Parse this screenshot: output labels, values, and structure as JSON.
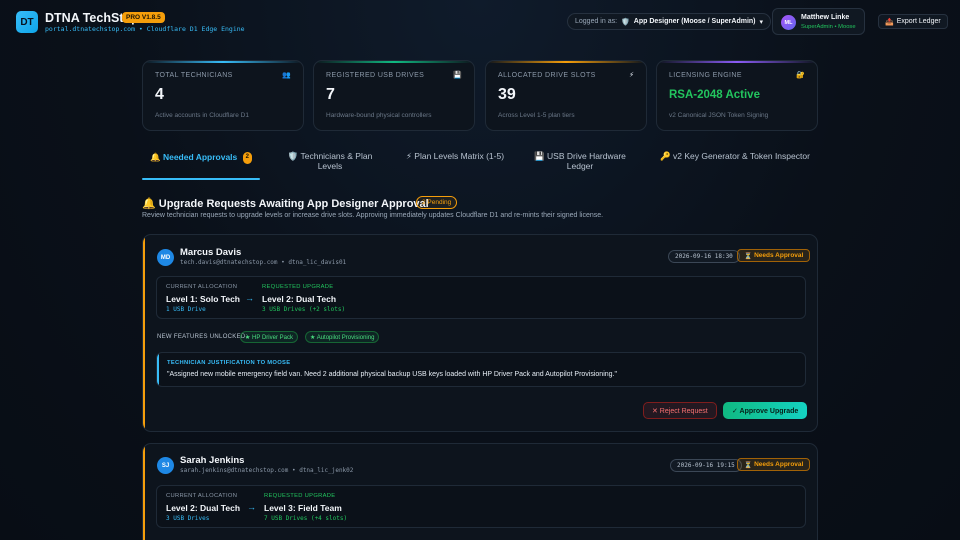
{
  "header": {
    "logo_text": "DT",
    "title": "DTNA TechStop",
    "version_badge": "PRO V1.8.5",
    "subtitle": "portal.dtnatechstop.com • Cloudflare D1 Edge Engine",
    "logged_in_label": "Logged in as:",
    "role_icon": "🛡️",
    "role_value": "App Designer (Moose / SuperAdmin)",
    "role_chevron": "▾",
    "user_initials": "ML",
    "user_name": "Matthew Linke",
    "user_role": "SuperAdmin • Moose",
    "export_icon": "📤",
    "export_label": "Export Ledger"
  },
  "stats": [
    {
      "label": "TOTAL TECHNICIANS",
      "icon": "👥",
      "value": "4",
      "desc": "Active accounts in Cloudflare D1",
      "color": "#38bdf8"
    },
    {
      "label": "REGISTERED USB DRIVES",
      "icon": "💾",
      "value": "7",
      "desc": "Hardware-bound physical controllers",
      "color": "#10b981"
    },
    {
      "label": "ALLOCATED DRIVE SLOTS",
      "icon": "⚡",
      "value": "39",
      "desc": "Across Level 1-5 plan tiers",
      "color": "#f59e0b"
    },
    {
      "label": "LICENSING ENGINE",
      "icon": "🔐",
      "value": "RSA-2048 Active",
      "desc": "v2 Canonical JSON Token Signing",
      "color": "#8b5cf6"
    }
  ],
  "tabs": [
    {
      "icon": "🔔",
      "label": "Needed Approvals",
      "count": "2"
    },
    {
      "icon": "🛡️",
      "label": "Technicians & Plan Levels"
    },
    {
      "icon": "⚡",
      "label": "Plan Levels Matrix (1-5)"
    },
    {
      "icon": "💾",
      "label": "USB Drive Hardware Ledger"
    },
    {
      "icon": "🔑",
      "label": "v2 Key Generator & Token Inspector"
    }
  ],
  "section": {
    "icon": "🔔",
    "title": "Upgrade Requests Awaiting App Designer Approval",
    "badge": "2 Pending",
    "desc": "Review technician requests to upgrade levels or increase drive slots. Approving immediately updates Cloudflare D1 and re-mints their signed license."
  },
  "requests": [
    {
      "initials": "MD",
      "name": "Marcus Davis",
      "meta": "tech.davis@dtnatechstop.com • dtna_lic_davis01",
      "date": "2026-09-16 18:30",
      "status": "Needs Approval",
      "status_icon": "⏳",
      "current_label": "CURRENT ALLOCATION",
      "current_level": "Level 1: Solo Tech",
      "current_drives": "1 USB Drive",
      "requested_label": "REQUESTED UPGRADE",
      "requested_level": "Level 2: Dual Tech",
      "requested_drives": "3 USB Drives (+2 slots)",
      "arrow": "→",
      "features_label": "NEW FEATURES UNLOCKED:",
      "features": [
        "★ HP Driver Pack",
        "★ Autopilot Provisioning"
      ],
      "justification_label": "TECHNICIAN JUSTIFICATION TO MOOSE",
      "justification": "\"Assigned new mobile emergency field van. Need 2 additional physical backup USB keys loaded with HP Driver Pack and Autopilot Provisioning.\"",
      "reject_label": "✕ Reject Request",
      "approve_label": "✓ Approve Upgrade"
    },
    {
      "initials": "SJ",
      "name": "Sarah Jenkins",
      "meta": "sarah.jenkins@dtnatechstop.com • dtna_lic_jenk02",
      "date": "2026-09-16 19:15",
      "status": "Needs Approval",
      "status_icon": "⏳",
      "current_label": "CURRENT ALLOCATION",
      "current_level": "Level 2: Dual Tech",
      "current_drives": "3 USB Drives",
      "requested_label": "REQUESTED UPGRADE",
      "requested_level": "Level 3: Field Team",
      "requested_drives": "7 USB Drives (+4 slots)",
      "arrow": "→"
    }
  ]
}
